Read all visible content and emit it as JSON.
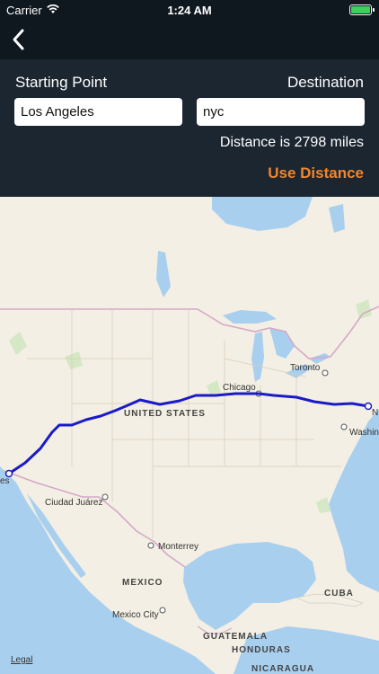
{
  "status": {
    "carrier": "Carrier",
    "time": "1:24 AM"
  },
  "nav": {
    "back_icon": "chevron-left-icon"
  },
  "form": {
    "start_label": "Starting Point",
    "dest_label": "Destination",
    "start_value": "Los Angeles",
    "dest_value": "nyc",
    "distance_text": "Distance is 2798 miles",
    "use_label": "Use Distance"
  },
  "map": {
    "labels": {
      "united_states": "UNITED STATES",
      "chicago": "Chicago",
      "toronto": "Toronto",
      "washington": "Washin",
      "new_york": "N",
      "los_angeles": "es",
      "ciudad_juarez": "Ciudad Juárez",
      "monterrey": "Monterrey",
      "mexico": "MEXICO",
      "mexico_city": "Mexico City",
      "cuba": "CUBA",
      "guatemala": "GUATEMALA",
      "honduras": "HONDURAS",
      "nicaragua": "NICARAGUA"
    },
    "legal": "Legal",
    "colors": {
      "route": "#1a1ac8",
      "water": "#a9cfef",
      "land": "#f3efe4",
      "parks": "#d5e8c5"
    }
  }
}
